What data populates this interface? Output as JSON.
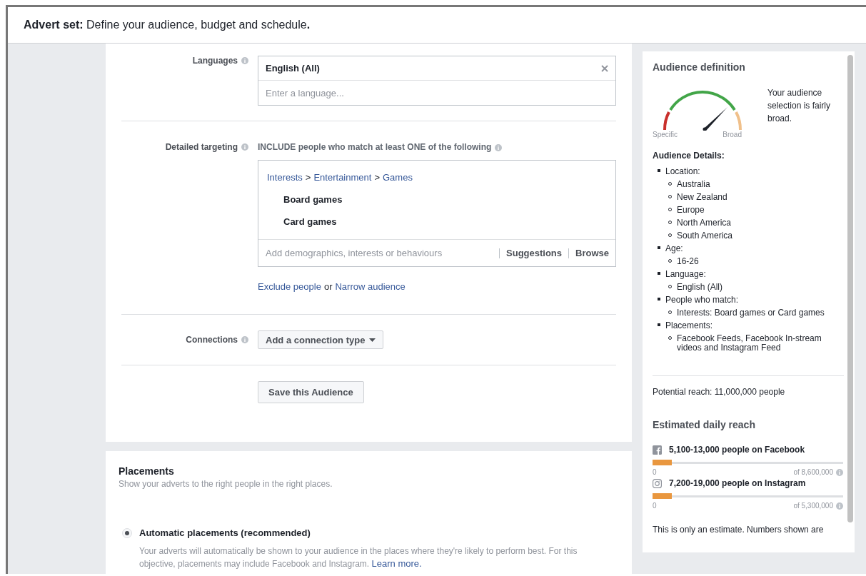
{
  "header": {
    "title": "**Advert set:** Define your audience, budget and schedule**.**"
  },
  "audience": {
    "languages": {
      "label": "Languages",
      "value": "English (All)",
      "placeholder": "Enter a language..."
    },
    "detailed_targeting": {
      "label": "Detailed targeting",
      "instruction": "INCLUDE people who match at least ONE of the following",
      "path": [
        "Interests",
        "Entertainment",
        "Games"
      ],
      "separator": ">",
      "items": [
        "Board games",
        "Card games"
      ],
      "placeholder": "Add demographics, interests or behaviours",
      "actions": [
        "Suggestions",
        "Browse"
      ],
      "exclude_link": "Exclude people",
      "joiner": "or",
      "narrow_link": "Narrow audience"
    },
    "connections": {
      "label": "Connections",
      "button": "Add a connection type"
    },
    "save_button": "Save this Audience"
  },
  "placements": {
    "title": "Placements",
    "subtitle": "Show your adverts to the right people in the right places.",
    "options": [
      {
        "label": "Automatic placements (recommended)",
        "selected": true,
        "description": "Your adverts will automatically be shown to your audience in the places where they're likely to perform best. For this objective, placements may include Facebook and Instagram.",
        "link": "Learn more."
      }
    ]
  },
  "sidebar": {
    "audience_definition": {
      "title": "Audience definition",
      "gauge_labels": [
        "Specific",
        "Broad"
      ],
      "summary": "Your audience selection is fairly broad.",
      "details_title": "Audience Details:",
      "details": [
        {
          "text": "Location:",
          "children": [
            {
              "text": "Australia"
            },
            {
              "text": "New Zealand"
            },
            {
              "text": "Europe"
            },
            {
              "text": "North America"
            },
            {
              "text": "South America"
            }
          ]
        },
        {
          "text": "Age:",
          "children": [
            {
              "text": "16-26"
            }
          ]
        },
        {
          "text": "Language:",
          "children": [
            {
              "text": "English (All)"
            }
          ]
        },
        {
          "text": "People who match:",
          "children": [
            {
              "text": "Interests: Board games or Card games"
            }
          ]
        },
        {
          "text": "Placements:",
          "children": [
            {
              "text": "Facebook Feeds, Facebook In-stream videos and Instagram Feed"
            }
          ]
        }
      ],
      "potential_reach": "Potential reach: 11,000,000 people"
    },
    "estimated_daily_reach": {
      "title": "Estimated daily reach",
      "platforms": [
        {
          "kind": "facebook",
          "text": "5,100-13,000 people on Facebook",
          "level": 0.1,
          "min": "0",
          "max": "of 8,600,000"
        },
        {
          "kind": "instagram",
          "text": "7,200-19,000 people on Instagram",
          "level": 0.1,
          "min": "0",
          "max": "of 5,300,000"
        }
      ],
      "note": "This is only an estimate. Numbers shown are"
    }
  }
}
